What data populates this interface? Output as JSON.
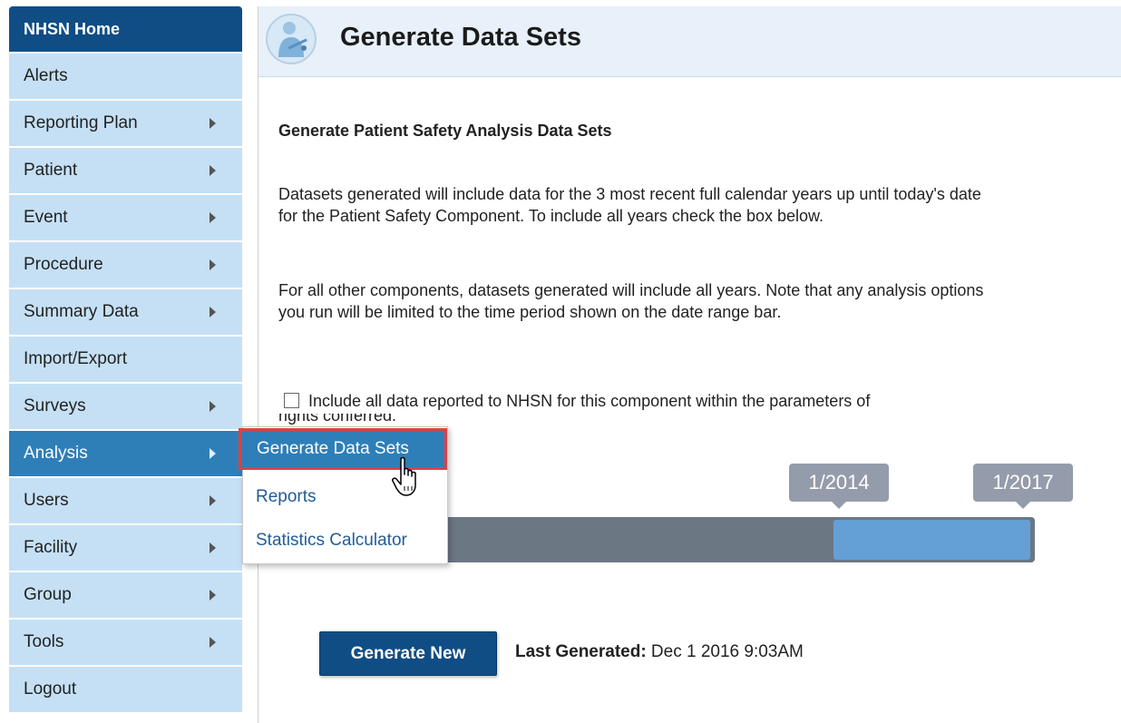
{
  "sidebar": {
    "items": [
      {
        "label": "NHSN Home"
      },
      {
        "label": "Alerts"
      },
      {
        "label": "Reporting Plan"
      },
      {
        "label": "Patient"
      },
      {
        "label": "Event"
      },
      {
        "label": "Procedure"
      },
      {
        "label": "Summary Data"
      },
      {
        "label": "Import/Export"
      },
      {
        "label": "Surveys"
      },
      {
        "label": "Analysis"
      },
      {
        "label": "Users"
      },
      {
        "label": "Facility"
      },
      {
        "label": "Group"
      },
      {
        "label": "Tools"
      },
      {
        "label": "Logout"
      }
    ]
  },
  "header": {
    "title": "Generate Data Sets"
  },
  "content": {
    "section_title": "Generate Patient Safety Analysis Data Sets",
    "para1": "Datasets generated will include data for the 3 most recent full calendar years up until today's date for the Patient Safety Component. To include all years check the box below.",
    "para2": "For all other components, datasets generated will include all years. Note that any analysis options you run will be limited to the time period shown on the date range bar.",
    "checkbox_label": "Include all data reported to NHSN for this component within the parameters of",
    "checkbox_label_cont": "rights conferred."
  },
  "flyout": {
    "items": [
      "Generate Data Sets",
      "Reports",
      "Statistics Calculator"
    ]
  },
  "range": {
    "start": "1/2014",
    "end": "1/2017"
  },
  "actions": {
    "generate_label": "Generate New",
    "last_generated_label": "Last Generated:",
    "last_generated_value": " Dec 1 2016 9:03AM"
  },
  "colors": {
    "nav_dark": "#0f4d84",
    "nav_light": "#c5e0f5",
    "nav_active": "#2e7fb8",
    "highlight": "#e04040"
  }
}
